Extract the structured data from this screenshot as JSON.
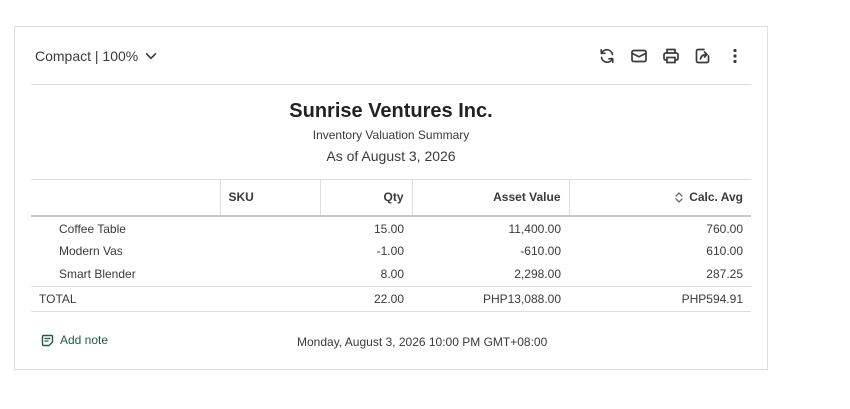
{
  "toolbar": {
    "view_label": "Compact | 100%",
    "icons": [
      "refresh-icon",
      "email-icon",
      "print-icon",
      "export-icon",
      "more-icon"
    ]
  },
  "report": {
    "company": "Sunrise Ventures Inc.",
    "name": "Inventory Valuation Summary",
    "as_of": "As of August 3, 2026"
  },
  "table": {
    "headers": {
      "name": "",
      "sku": "SKU",
      "qty": "Qty",
      "asset_value": "Asset Value",
      "calc_avg": "Calc. Avg"
    },
    "rows": [
      {
        "name": "Coffee Table",
        "sku": "",
        "qty": "15.00",
        "asset_value": "11,400.00",
        "calc_avg": "760.00"
      },
      {
        "name": "Modern Vas",
        "sku": "",
        "qty": "-1.00",
        "asset_value": "-610.00",
        "calc_avg": "610.00"
      },
      {
        "name": "Smart Blender",
        "sku": "",
        "qty": "8.00",
        "asset_value": "2,298.00",
        "calc_avg": "287.25"
      }
    ],
    "total": {
      "name": "TOTAL",
      "sku": "",
      "qty": "22.00",
      "asset_value": "PHP13,088.00",
      "calc_avg": "PHP594.91"
    }
  },
  "footer": {
    "add_note_label": "Add note",
    "timestamp": "Monday, August 3, 2026 10:00 PM GMT+08:00"
  },
  "colors": {
    "accent_green": "#1f5c43",
    "border": "#dcdee0",
    "text": "#393a3d"
  }
}
